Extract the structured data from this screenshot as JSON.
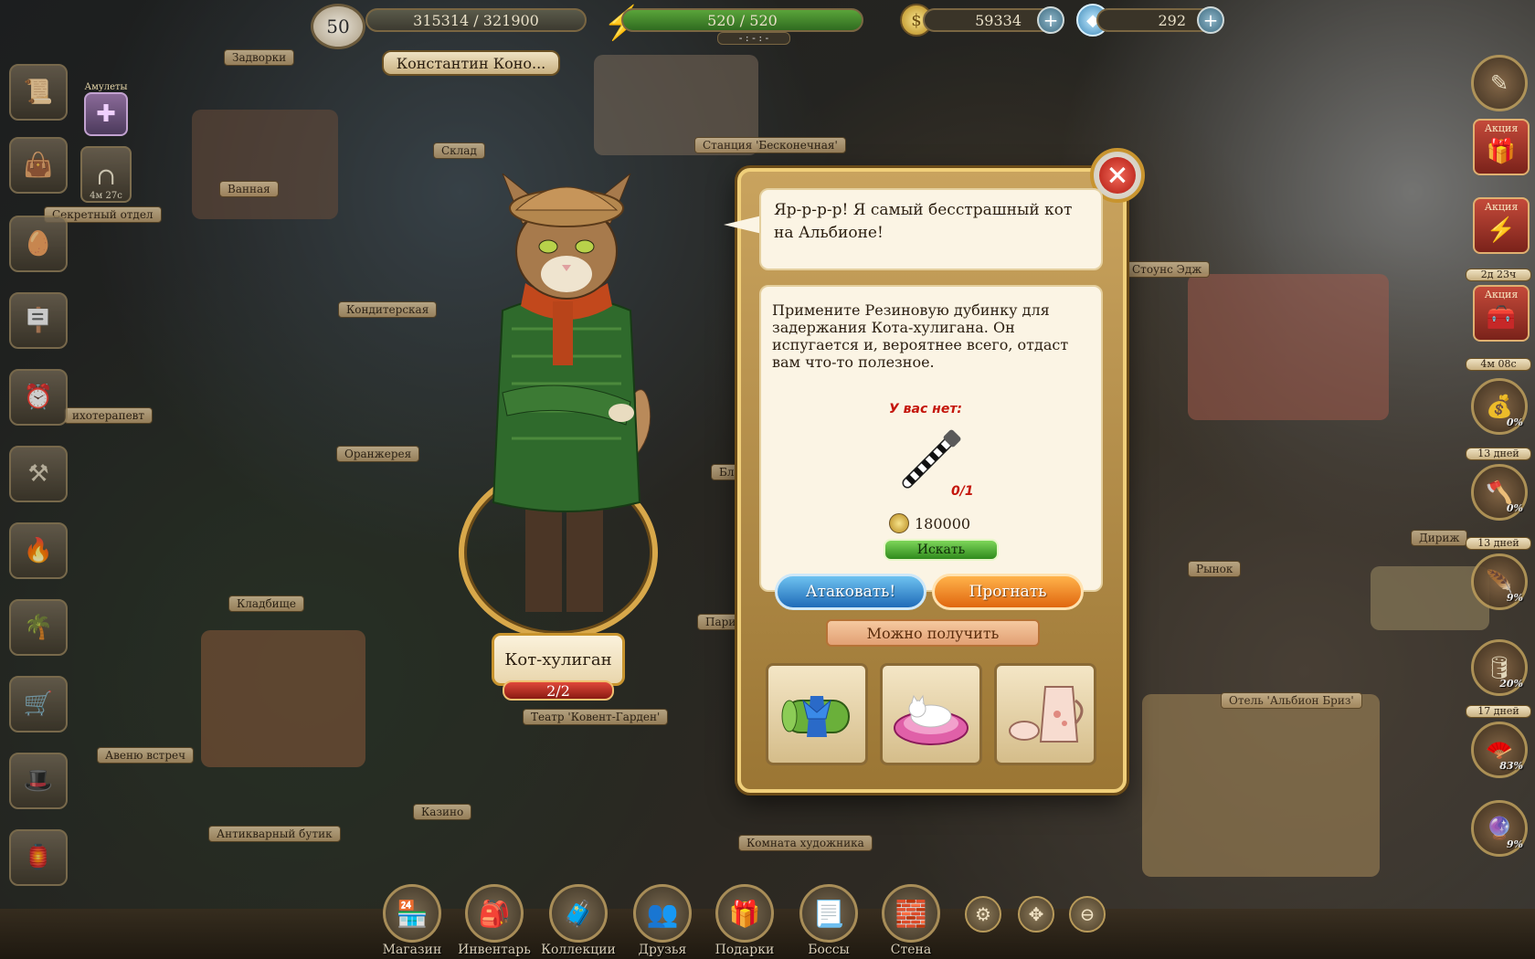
{
  "top": {
    "level": "50",
    "xp": "315314 / 321900",
    "energy": "520 / 520",
    "energy_timer": "- : - : -",
    "gold": "59334",
    "gems": "292",
    "player_name": "Константин Коно..."
  },
  "map_labels": [
    "Задворки",
    "Склад",
    "Ванная",
    "Секретный отдел",
    "Кондитерская",
    "Станция 'Бесконечная'",
    "Стоунс Эдж",
    "ихотерапевт",
    "Оранжерея",
    "Кладбище",
    "Парик",
    "Рынок",
    "Дириж",
    "Театр 'Ковент-Гарден'",
    "Отель 'Альбион Бриз'",
    "Авеню встреч",
    "Казино",
    "Антикварный бутик",
    "Комната художника",
    "Бланс"
  ],
  "left_sidebar": {
    "amulet_label": "Амулеты",
    "timer_label": "4м 27с"
  },
  "right_sidebar": {
    "promo_label": "Акция",
    "promo_timers": [
      "2д 23ч",
      "4м 08с"
    ],
    "collection_timers": [
      "13 дней",
      "13 дней",
      "17 дней"
    ],
    "progress": [
      "0%",
      "0%",
      "9%",
      "20%",
      "83%",
      "9%"
    ]
  },
  "character": {
    "name": "Кот-хулиган",
    "hp": "2/2"
  },
  "dialog": {
    "speech": "Яр-р-р-р! Я самый бесстрашный кот на Альбионе!",
    "description": "Примените Резиновую дубинку для задержания Кота-хулигана. Он испугается и, вероятнее всего, отдаст вам что-то полезное.",
    "missing_label": "У вас нет:",
    "item_count": "0/1",
    "price": "180000",
    "search_button": "Искать",
    "attack_button": "Атаковать!",
    "drive_away_button": "Прогнать",
    "rewards_title": "Можно получить",
    "close_symbol": "×"
  },
  "bottom_bar": {
    "shop": "Магазин",
    "inventory": "Инвентарь",
    "collections": "Коллекции",
    "friends": "Друзья",
    "gifts": "Подарки",
    "bosses": "Боссы",
    "wall": "Стена"
  },
  "colors": {
    "dialog_gold": "#f0cf7a",
    "attack_blue": "#1f6bb8",
    "drive_orange": "#e0670f",
    "search_green": "#2f8a1c",
    "warning_red": "#c4160c"
  }
}
